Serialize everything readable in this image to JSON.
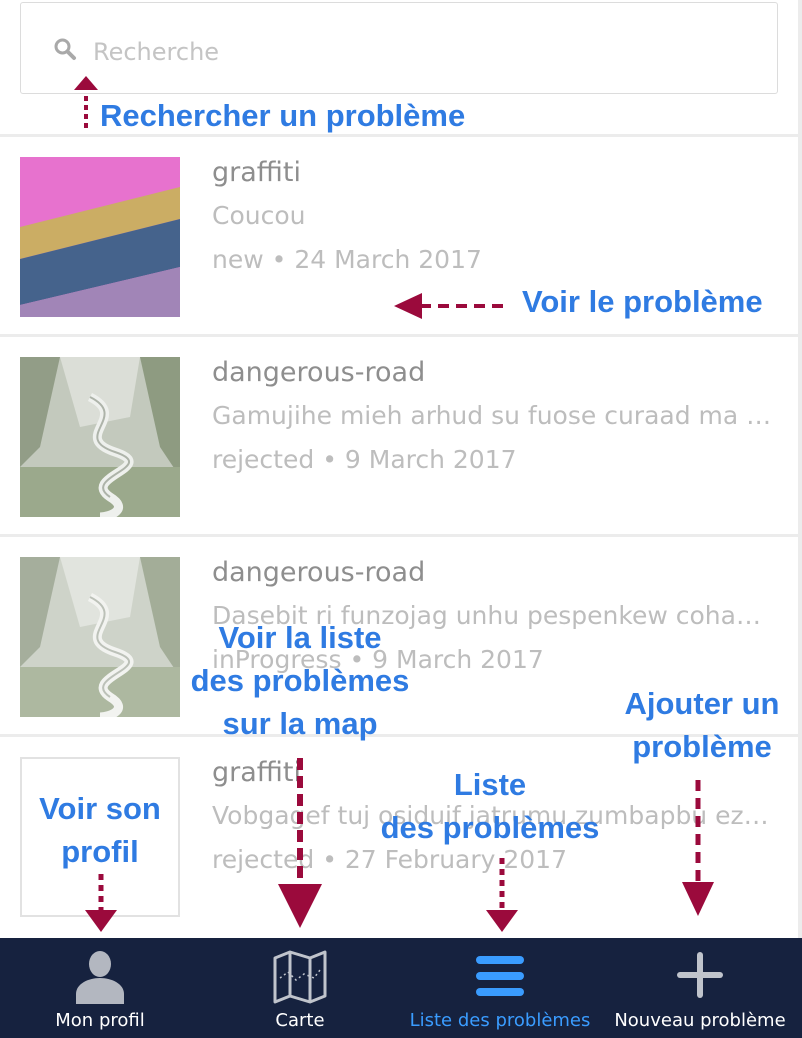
{
  "search": {
    "placeholder": "Recherche"
  },
  "issues": [
    {
      "title": "graffiti",
      "description": "Coucou",
      "status": "new",
      "date": "24 March 2017",
      "thumbnail": "colorful-fabric"
    },
    {
      "title": "dangerous-road",
      "description": "Gamujihe mieh arhud su fuose curaad ma w...",
      "status": "rejected",
      "date": "9 March 2017",
      "thumbnail": "mountain-road"
    },
    {
      "title": "dangerous-road",
      "description": "Dasebit ri funzojag unhu pespenkew cohaz ...",
      "status": "inProgress",
      "date": "9 March 2017",
      "thumbnail": "mountain-road"
    },
    {
      "title": "graffiti",
      "description": "Vobgagef tuj osiduif jatrumu zumbapbu ez j...",
      "status": "rejected",
      "date": "27 February 2017",
      "thumbnail": "none"
    }
  ],
  "meta_separator": "•",
  "tabbar": {
    "tabs": [
      {
        "label": "Mon profil",
        "icon": "user-icon",
        "active": false
      },
      {
        "label": "Carte",
        "icon": "map-icon",
        "active": false
      },
      {
        "label": "Liste des problèmes",
        "icon": "list-icon",
        "active": true
      },
      {
        "label": "Nouveau problème",
        "icon": "plus-icon",
        "active": false
      }
    ]
  },
  "annotations": {
    "search": "Rechercher un problème",
    "view_issue": "Voir le problème",
    "map_line1": "Voir la liste",
    "map_line2": "des problèmes",
    "map_line3": "sur la map",
    "add_line1": "Ajouter un",
    "add_line2": "problème",
    "list_line1": "Liste",
    "list_line2": "des problèmes",
    "profile_line1": "Voir son",
    "profile_line2": "profil"
  },
  "colors": {
    "tabbar_bg": "#16223f",
    "active_tab": "#3a9cff",
    "annotation_text": "#2f7be2",
    "annotation_arrow": "#9b0a3c"
  }
}
